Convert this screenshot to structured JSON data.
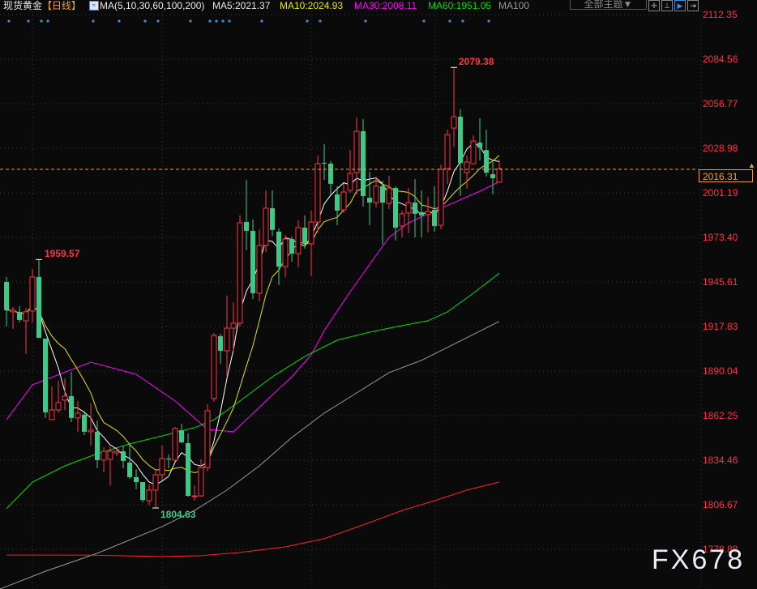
{
  "header": {
    "symbol": "现货黄金",
    "period": "【日线】",
    "ma_params": "MA(5,10,30,60,100,200)",
    "ma5": "MA5:2021.37",
    "ma10": "MA10:2024.93",
    "ma30": "MA30:2008.11",
    "ma60": "MA60:1951.05",
    "ma100": "MA100",
    "theme_button": "全部主题▼"
  },
  "watermark": "FX678",
  "colors": {
    "up": "#ff3344",
    "down": "#3dc98a",
    "ma5": "#ffffff",
    "ma10": "#e6e600",
    "ma30": "#ff00ff",
    "ma60": "#00dd00",
    "ma100": "#9a9a9a",
    "ma200": "#ff2020",
    "current": "#f0a030"
  },
  "chart_data": {
    "type": "candlestick",
    "title": "现货黄金 日线",
    "y_axis_ticks": [
      "2112.35",
      "2084.56",
      "2056.77",
      "2028.98",
      "2001.19",
      "1973.40",
      "1945.61",
      "1917.83",
      "1890.04",
      "1862.25",
      "1834.46",
      "1806.67",
      "1778.88"
    ],
    "ylim": [
      1778.88,
      2112.35
    ],
    "current_price": "2016.31",
    "annotations": {
      "high": "2079.38",
      "low": "1804.63",
      "local_high": "1959.57"
    },
    "event_marker_candles": [
      0,
      3,
      5,
      6,
      13,
      17,
      21,
      23,
      28,
      31,
      32,
      33,
      34,
      39,
      46,
      48,
      55,
      64,
      68,
      70,
      74
    ],
    "ohlc": [
      [
        1945.6,
        1948.7,
        1917.9,
        1928.0
      ],
      [
        1927.0,
        1930.0,
        1916.3,
        1928.0
      ],
      [
        1927.0,
        1930.5,
        1920.4,
        1921.9
      ],
      [
        1921.4,
        1929.5,
        1900.7,
        1927.0
      ],
      [
        1927.5,
        1953.7,
        1920.4,
        1948.7
      ],
      [
        1948.7,
        1959.57,
        1910.8,
        1910.8
      ],
      [
        1910.3,
        1910.3,
        1860.8,
        1864.3
      ],
      [
        1859.8,
        1880.5,
        1859.8,
        1865.8
      ],
      [
        1865.8,
        1884.0,
        1864.3,
        1870.4
      ],
      [
        1871.9,
        1885.5,
        1865.8,
        1874.4
      ],
      [
        1874.4,
        1889.6,
        1858.2,
        1860.8
      ],
      [
        1860.8,
        1871.4,
        1852.2,
        1863.8
      ],
      [
        1862.8,
        1865.3,
        1850.1,
        1852.2
      ],
      [
        1852.2,
        1869.9,
        1843.6,
        1853.2
      ],
      [
        1852.2,
        1859.2,
        1829.4,
        1834.5
      ],
      [
        1834.5,
        1842.6,
        1826.9,
        1840.0
      ],
      [
        1835.0,
        1842.6,
        1818.8,
        1840.0
      ],
      [
        1839.0,
        1841.6,
        1837.0,
        1840.0
      ],
      [
        1840.0,
        1843.1,
        1829.4,
        1834.0
      ],
      [
        1833.0,
        1844.6,
        1822.9,
        1823.9
      ],
      [
        1823.9,
        1828.9,
        1816.3,
        1820.8
      ],
      [
        1820.8,
        1820.8,
        1808.2,
        1809.7
      ],
      [
        1809.2,
        1819.3,
        1806.2,
        1815.8
      ],
      [
        1815.8,
        1827.9,
        1804.63,
        1825.4
      ],
      [
        1825.4,
        1843.6,
        1821.8,
        1835.5
      ],
      [
        1835.5,
        1838.0,
        1829.4,
        1835.0
      ],
      [
        1834.5,
        1855.2,
        1833.5,
        1854.2
      ],
      [
        1853.2,
        1857.2,
        1845.1,
        1845.6
      ],
      [
        1845.1,
        1851.2,
        1811.7,
        1812.2
      ],
      [
        1811.7,
        1818.8,
        1809.2,
        1812.2
      ],
      [
        1812.2,
        1835.0,
        1811.7,
        1829.9
      ],
      [
        1829.9,
        1869.3,
        1827.4,
        1865.3
      ],
      [
        1872.9,
        1913.8,
        1870.9,
        1912.3
      ],
      [
        1911.8,
        1913.3,
        1894.6,
        1902.7
      ],
      [
        1902.7,
        1937.1,
        1886.5,
        1916.8
      ],
      [
        1916.8,
        1933.0,
        1902.2,
        1919.9
      ],
      [
        1919.9,
        1987.1,
        1917.9,
        1982.5
      ],
      [
        1983.0,
        2009.3,
        1965.4,
        1977.5
      ],
      [
        1977.5,
        1984.6,
        1935.0,
        1938.6
      ],
      [
        1938.6,
        1978.5,
        1933.5,
        1968.4
      ],
      [
        1968.4,
        2002.7,
        1964.3,
        1991.6
      ],
      [
        1991.6,
        2002.7,
        1974.4,
        1978.0
      ],
      [
        1977.0,
        1979.0,
        1943.6,
        1955.2
      ],
      [
        1955.2,
        1974.9,
        1948.7,
        1972.4
      ],
      [
        1972.4,
        1973.9,
        1958.3,
        1963.3
      ],
      [
        1963.3,
        1984.0,
        1954.7,
        1979.5
      ],
      [
        1979.5,
        1987.1,
        1966.4,
        1969.9
      ],
      [
        1969.4,
        1990.1,
        1949.2,
        1983.0
      ],
      [
        1983.0,
        2024.5,
        1976.5,
        2019.4
      ],
      [
        2019.9,
        2031.6,
        2009.3,
        2019.4
      ],
      [
        2019.4,
        2021.0,
        2000.2,
        2006.8
      ],
      [
        2000.2,
        2005.3,
        1981.0,
        1990.1
      ],
      [
        1990.6,
        2006.8,
        1988.6,
        2001.7
      ],
      [
        2002.7,
        2028.0,
        2001.2,
        2013.3
      ],
      [
        2013.8,
        2048.2,
        2000.2,
        2039.6
      ],
      [
        2039.6,
        2047.2,
        1992.6,
        1999.2
      ],
      [
        1998.1,
        2014.3,
        1981.0,
        1995.1
      ],
      [
        1995.1,
        2011.3,
        1992.1,
        2005.3
      ],
      [
        2005.3,
        2008.8,
        1968.9,
        1995.1
      ],
      [
        1994.6,
        2011.8,
        1991.1,
        2004.2
      ],
      [
        2004.2,
        2005.3,
        1971.4,
        1979.5
      ],
      [
        1980.5,
        1990.1,
        1973.4,
        1988.1
      ],
      [
        1988.6,
        2004.2,
        1975.9,
        1995.1
      ],
      [
        1995.1,
        2009.8,
        1973.4,
        1988.1
      ],
      [
        1989.1,
        2002.7,
        1973.4,
        1987.1
      ],
      [
        1987.6,
        1998.7,
        1976.5,
        1989.6
      ],
      [
        1990.6,
        2005.3,
        1977.0,
        1980.5
      ],
      [
        1981.0,
        2018.9,
        1978.5,
        2015.8
      ],
      [
        2016.3,
        2040.6,
        2006.8,
        2037.5
      ],
      [
        2041.6,
        2079.38,
        2029.9,
        2048.7
      ],
      [
        2048.7,
        2053.4,
        1999.2,
        2019.9
      ],
      [
        2013.8,
        2024.5,
        2003.7,
        2020.4
      ],
      [
        2019.4,
        2037.0,
        2018.9,
        2033.5
      ],
      [
        2032.5,
        2047.7,
        2021.4,
        2029.4
      ],
      [
        2027.9,
        2040.6,
        2011.3,
        2013.8
      ],
      [
        2012.8,
        2020.4,
        2000.2,
        2010.3
      ],
      [
        2007.8,
        2021.9,
        2007.8,
        2016.31
      ]
    ],
    "moving_averages": {
      "MA30": [
        [
          0,
          1859.7
        ],
        [
          4,
          1881.5
        ],
        [
          13,
          1895.6
        ],
        [
          20,
          1888.0
        ],
        [
          26,
          1871.4
        ],
        [
          31,
          1853.7
        ],
        [
          35,
          1852.2
        ],
        [
          37,
          1859.7
        ],
        [
          40,
          1871.4
        ],
        [
          44,
          1886.5
        ],
        [
          47,
          1900.2
        ],
        [
          49,
          1915.3
        ],
        [
          53,
          1939.5
        ],
        [
          57,
          1962.3
        ],
        [
          59,
          1973.4
        ],
        [
          62,
          1982.5
        ],
        [
          66,
          1990.1
        ],
        [
          69,
          1995.1
        ],
        [
          73,
          2002.2
        ],
        [
          76,
          2008.11
        ]
      ],
      "MA60": [
        [
          0,
          1804.2
        ],
        [
          4,
          1820.8
        ],
        [
          9,
          1830.9
        ],
        [
          14,
          1838.5
        ],
        [
          19,
          1844.6
        ],
        [
          24,
          1849.6
        ],
        [
          29,
          1854.7
        ],
        [
          32,
          1859.7
        ],
        [
          36,
          1871.4
        ],
        [
          41,
          1886.5
        ],
        [
          46,
          1899.2
        ],
        [
          51,
          1909.3
        ],
        [
          56,
          1914.3
        ],
        [
          61,
          1918.4
        ],
        [
          65,
          1921.4
        ],
        [
          68,
          1926.9
        ],
        [
          72,
          1938.6
        ],
        [
          76,
          1951.05
        ]
      ],
      "MA100": [
        [
          -1,
          1754.1
        ],
        [
          6,
          1765.2
        ],
        [
          14,
          1776.4
        ],
        [
          24,
          1793.0
        ],
        [
          29,
          1803.1
        ],
        [
          34,
          1815.8
        ],
        [
          39,
          1830.9
        ],
        [
          44,
          1848.6
        ],
        [
          49,
          1863.8
        ],
        [
          54,
          1876.4
        ],
        [
          59,
          1889.1
        ],
        [
          64,
          1896.7
        ],
        [
          69,
          1906.8
        ],
        [
          76,
          1921.0
        ]
      ],
      "MA200": [
        [
          0,
          1775.3
        ],
        [
          12,
          1775.3
        ],
        [
          24,
          1774.4
        ],
        [
          30,
          1774.9
        ],
        [
          36,
          1776.9
        ],
        [
          43,
          1780.4
        ],
        [
          49,
          1785.5
        ],
        [
          55,
          1794.1
        ],
        [
          61,
          1803.1
        ],
        [
          66,
          1809.2
        ],
        [
          71,
          1815.8
        ],
        [
          76,
          1820.8
        ]
      ]
    }
  }
}
